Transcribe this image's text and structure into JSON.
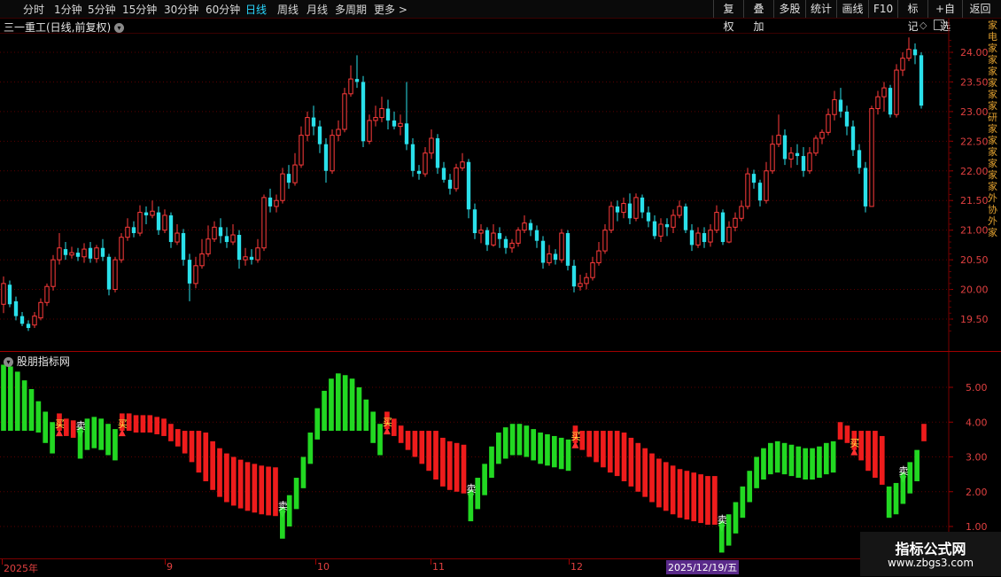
{
  "toolbar": {
    "periods": [
      "分时",
      "1分钟",
      "5分钟",
      "15分钟",
      "30分钟",
      "60分钟",
      "日线",
      "周线",
      "月线",
      "多周期",
      "更多 >"
    ],
    "active_period": "日线",
    "buttons": [
      "复权",
      "叠加",
      "多股",
      "统计",
      "画线",
      "F10",
      "标记",
      "+自选",
      "返回"
    ]
  },
  "chart": {
    "title": "三一重工(日线,前复权)",
    "price_axis": [
      "24.00",
      "23.50",
      "23.00",
      "22.50",
      "22.00",
      "21.50",
      "21.00",
      "20.50",
      "20.00",
      "19.50"
    ],
    "indicator_title": "股朋指标网",
    "indicator_axis": [
      "5.00",
      "4.00",
      "3.00",
      "2.00",
      "1.00"
    ],
    "date_labels": [
      "2025年",
      "9",
      "10",
      "11",
      "12"
    ],
    "selected_date": "2025/12/19/五",
    "buy_label": "买",
    "sell_label": "卖",
    "colors": {
      "up": "#ff3b3b",
      "down": "#2ae0ea",
      "bar_green": "#22d822",
      "bar_red": "#ee1c1c",
      "grid": "#5a0000"
    }
  },
  "chart_data": [
    {
      "type": "candlestick",
      "title": "三一重工(日线,前复权)",
      "ylim": [
        19.2,
        24.5
      ],
      "candles": [
        [
          19.75,
          20.1,
          20.22,
          19.6
        ],
        [
          20.08,
          19.75,
          20.15,
          19.7
        ],
        [
          19.8,
          19.55,
          19.88,
          19.48
        ],
        [
          19.55,
          19.42,
          19.62,
          19.38
        ],
        [
          19.42,
          19.35,
          19.48,
          19.3
        ],
        [
          19.4,
          19.55,
          19.62,
          19.35
        ],
        [
          19.52,
          19.78,
          19.85,
          19.48
        ],
        [
          19.78,
          20.05,
          20.1,
          19.72
        ],
        [
          20.05,
          20.5,
          20.58,
          19.98
        ],
        [
          20.5,
          20.7,
          20.95,
          20.42
        ],
        [
          20.68,
          20.58,
          20.8,
          20.5
        ],
        [
          20.58,
          20.62,
          20.72,
          20.52
        ],
        [
          20.62,
          20.55,
          20.7,
          20.48
        ],
        [
          20.55,
          20.68,
          20.78,
          20.45
        ],
        [
          20.7,
          20.52,
          20.8,
          20.45
        ],
        [
          20.52,
          20.7,
          20.75,
          20.45
        ],
        [
          20.7,
          20.55,
          20.85,
          20.48
        ],
        [
          20.55,
          20.0,
          20.6,
          19.9
        ],
        [
          20.0,
          20.5,
          20.55,
          19.95
        ],
        [
          20.5,
          20.88,
          20.95,
          20.45
        ],
        [
          20.88,
          21.05,
          21.2,
          20.82
        ],
        [
          21.05,
          20.95,
          21.15,
          20.88
        ],
        [
          20.95,
          21.3,
          21.42,
          20.9
        ],
        [
          21.3,
          21.25,
          21.4,
          21.1
        ],
        [
          21.25,
          21.32,
          21.5,
          21.2
        ],
        [
          21.3,
          21.0,
          21.4,
          20.92
        ],
        [
          21.0,
          21.25,
          21.35,
          20.95
        ],
        [
          21.25,
          20.8,
          21.3,
          20.7
        ],
        [
          20.8,
          20.95,
          21.1,
          20.75
        ],
        [
          20.95,
          20.5,
          21.02,
          20.4
        ],
        [
          20.5,
          20.1,
          20.6,
          19.8
        ],
        [
          20.1,
          20.4,
          20.55,
          20.02
        ],
        [
          20.4,
          20.6,
          20.85,
          20.35
        ],
        [
          20.6,
          20.85,
          21.08,
          20.55
        ],
        [
          20.85,
          21.05,
          21.15,
          20.8
        ],
        [
          21.05,
          20.9,
          21.2,
          20.78
        ],
        [
          20.9,
          20.8,
          21.05,
          20.7
        ],
        [
          20.8,
          20.92,
          21.1,
          20.75
        ],
        [
          20.92,
          20.5,
          21.0,
          20.35
        ],
        [
          20.5,
          20.55,
          20.7,
          20.4
        ],
        [
          20.55,
          20.5,
          20.68,
          20.42
        ],
        [
          20.5,
          20.7,
          20.85,
          20.45
        ],
        [
          20.7,
          21.55,
          21.6,
          20.65
        ],
        [
          21.55,
          21.4,
          21.7,
          21.3
        ],
        [
          21.4,
          21.5,
          21.6,
          21.3
        ],
        [
          21.5,
          21.95,
          22.05,
          21.45
        ],
        [
          21.95,
          21.8,
          22.1,
          21.7
        ],
        [
          21.8,
          22.1,
          22.3,
          21.75
        ],
        [
          22.1,
          22.6,
          22.75,
          22.05
        ],
        [
          22.6,
          22.9,
          23.0,
          22.5
        ],
        [
          22.9,
          22.75,
          23.1,
          22.6
        ],
        [
          22.75,
          22.45,
          22.85,
          22.3
        ],
        [
          22.45,
          22.0,
          22.55,
          21.8
        ],
        [
          22.0,
          22.6,
          22.7,
          21.95
        ],
        [
          22.6,
          22.7,
          22.85,
          22.5
        ],
        [
          22.7,
          23.3,
          23.4,
          22.65
        ],
        [
          23.3,
          23.55,
          23.78,
          23.25
        ],
        [
          23.55,
          23.5,
          23.95,
          23.4
        ],
        [
          23.5,
          22.5,
          23.6,
          22.4
        ],
        [
          22.5,
          22.85,
          22.95,
          22.45
        ],
        [
          22.85,
          22.9,
          23.1,
          22.75
        ],
        [
          22.9,
          23.05,
          23.25,
          22.82
        ],
        [
          23.05,
          22.85,
          23.2,
          22.7
        ],
        [
          22.85,
          22.75,
          23.0,
          22.7
        ],
        [
          22.75,
          22.8,
          22.95,
          22.6
        ],
        [
          22.8,
          22.45,
          23.5,
          22.35
        ],
        [
          22.45,
          22.0,
          22.55,
          21.9
        ],
        [
          22.0,
          21.95,
          22.1,
          21.85
        ],
        [
          21.95,
          22.3,
          22.4,
          21.9
        ],
        [
          22.3,
          22.55,
          22.7,
          22.2
        ],
        [
          22.55,
          22.05,
          22.62,
          21.95
        ],
        [
          22.05,
          21.85,
          22.15,
          21.8
        ],
        [
          21.85,
          21.7,
          21.95,
          21.6
        ],
        [
          21.7,
          22.05,
          22.12,
          21.65
        ],
        [
          22.05,
          22.15,
          22.3,
          22.0
        ],
        [
          22.15,
          21.35,
          22.2,
          21.2
        ],
        [
          21.35,
          20.95,
          21.45,
          20.85
        ],
        [
          20.95,
          21.0,
          21.1,
          20.78
        ],
        [
          21.0,
          20.75,
          21.05,
          20.65
        ],
        [
          20.75,
          20.95,
          21.1,
          20.72
        ],
        [
          20.95,
          20.85,
          21.05,
          20.7
        ],
        [
          20.85,
          20.7,
          20.9,
          20.6
        ],
        [
          20.7,
          20.78,
          20.85,
          20.62
        ],
        [
          20.78,
          21.0,
          21.05,
          20.72
        ],
        [
          21.0,
          21.12,
          21.25,
          20.95
        ],
        [
          21.12,
          21.0,
          21.18,
          20.9
        ],
        [
          21.0,
          20.82,
          21.08,
          20.7
        ],
        [
          20.82,
          20.45,
          20.9,
          20.35
        ],
        [
          20.45,
          20.6,
          20.75,
          20.4
        ],
        [
          20.6,
          20.5,
          20.68,
          20.42
        ],
        [
          20.5,
          20.95,
          21.02,
          20.45
        ],
        [
          20.95,
          20.4,
          21.0,
          20.32
        ],
        [
          20.4,
          20.05,
          20.5,
          19.95
        ],
        [
          20.05,
          20.1,
          20.25,
          19.98
        ],
        [
          20.1,
          20.2,
          20.28,
          20.0
        ],
        [
          20.2,
          20.45,
          20.55,
          20.15
        ],
        [
          20.45,
          20.65,
          20.8,
          20.4
        ],
        [
          20.65,
          21.0,
          21.1,
          20.6
        ],
        [
          21.0,
          21.4,
          21.48,
          20.95
        ],
        [
          21.4,
          21.3,
          21.5,
          21.15
        ],
        [
          21.3,
          21.45,
          21.55,
          21.2
        ],
        [
          21.45,
          21.2,
          21.62,
          21.1
        ],
        [
          21.2,
          21.55,
          21.62,
          21.15
        ],
        [
          21.55,
          21.3,
          21.6,
          21.2
        ],
        [
          21.3,
          21.15,
          21.4,
          21.05
        ],
        [
          21.15,
          20.9,
          21.25,
          20.85
        ],
        [
          20.9,
          21.1,
          21.2,
          20.8
        ],
        [
          21.1,
          21.05,
          21.2,
          20.9
        ],
        [
          21.05,
          21.25,
          21.35,
          20.95
        ],
        [
          21.25,
          21.4,
          21.5,
          21.2
        ],
        [
          21.4,
          21.0,
          21.45,
          20.95
        ],
        [
          21.0,
          20.75,
          21.1,
          20.65
        ],
        [
          20.75,
          20.95,
          21.05,
          20.7
        ],
        [
          20.95,
          20.8,
          21.05,
          20.7
        ],
        [
          20.8,
          21.0,
          21.1,
          20.72
        ],
        [
          21.0,
          21.3,
          21.42,
          20.95
        ],
        [
          21.3,
          20.8,
          21.35,
          20.75
        ],
        [
          20.8,
          21.05,
          21.15,
          20.78
        ],
        [
          21.05,
          21.2,
          21.3,
          20.98
        ],
        [
          21.2,
          21.4,
          21.5,
          21.15
        ],
        [
          21.4,
          21.95,
          22.05,
          21.35
        ],
        [
          21.95,
          21.8,
          22.02,
          21.7
        ],
        [
          21.8,
          21.5,
          21.85,
          21.4
        ],
        [
          21.5,
          22.0,
          22.15,
          21.45
        ],
        [
          22.0,
          22.45,
          22.6,
          21.95
        ],
        [
          22.45,
          22.6,
          22.95,
          22.4
        ],
        [
          22.6,
          22.2,
          22.7,
          22.1
        ],
        [
          22.2,
          22.3,
          22.4,
          22.05
        ],
        [
          22.3,
          22.25,
          22.45,
          22.1
        ],
        [
          22.25,
          22.0,
          22.4,
          21.9
        ],
        [
          22.0,
          22.3,
          22.4,
          21.95
        ],
        [
          22.3,
          22.55,
          22.6,
          22.25
        ],
        [
          22.55,
          22.65,
          22.7,
          22.45
        ],
        [
          22.65,
          22.95,
          23.05,
          22.6
        ],
        [
          22.95,
          23.2,
          23.35,
          22.85
        ],
        [
          23.2,
          23.0,
          23.4,
          22.9
        ],
        [
          23.0,
          22.75,
          23.1,
          22.6
        ],
        [
          22.75,
          22.35,
          22.85,
          22.25
        ],
        [
          22.35,
          22.05,
          22.45,
          21.95
        ],
        [
          22.05,
          21.4,
          22.15,
          21.3
        ],
        [
          21.4,
          23.05,
          23.1,
          21.4
        ],
        [
          23.05,
          23.25,
          23.35,
          22.95
        ],
        [
          23.25,
          23.4,
          23.5,
          23.0
        ],
        [
          23.4,
          22.95,
          23.45,
          22.9
        ],
        [
          22.95,
          23.7,
          23.8,
          22.9
        ],
        [
          23.7,
          23.9,
          24.0,
          23.6
        ],
        [
          23.9,
          24.05,
          24.25,
          23.85
        ],
        [
          24.05,
          23.95,
          24.15,
          23.8
        ],
        [
          23.95,
          23.1,
          24.0,
          23.05
        ]
      ]
    },
    {
      "type": "bar",
      "title": "股朋指标网",
      "ylim": [
        0.6,
        6.0
      ],
      "values": [
        5.65,
        5.6,
        5.45,
        5.2,
        4.95,
        4.6,
        4.3,
        4.0,
        3.75,
        3.6,
        3.55,
        3.85,
        4.1,
        4.15,
        4.1,
        3.95,
        3.8,
        3.75,
        3.75,
        3.7,
        3.7,
        3.7,
        3.65,
        3.6,
        3.45,
        3.3,
        3.1,
        2.85,
        2.55,
        2.3,
        2.05,
        1.85,
        1.7,
        1.6,
        1.52,
        1.45,
        1.4,
        1.35,
        1.32,
        1.3,
        1.55,
        1.9,
        2.4,
        3.0,
        3.7,
        4.4,
        4.9,
        5.25,
        5.4,
        5.35,
        5.25,
        5.0,
        4.65,
        4.3,
        3.95,
        3.8,
        3.6,
        3.4,
        3.2,
        3.0,
        2.8,
        2.6,
        2.35,
        2.15,
        2.05,
        2.0,
        1.95,
        2.05,
        2.4,
        2.8,
        3.3,
        3.7,
        3.85,
        3.95,
        3.95,
        3.9,
        3.8,
        3.7,
        3.65,
        3.6,
        3.55,
        3.5,
        3.4,
        3.2,
        3.0,
        2.85,
        2.7,
        2.55,
        2.45,
        2.3,
        2.15,
        2.0,
        1.85,
        1.7,
        1.55,
        1.45,
        1.35,
        1.25,
        1.2,
        1.15,
        1.1,
        1.05,
        1.05,
        1.15,
        1.35,
        1.7,
        2.15,
        2.6,
        3.0,
        3.25,
        3.4,
        3.45,
        3.4,
        3.35,
        3.3,
        3.25,
        3.25,
        3.3,
        3.4,
        3.45,
        3.5,
        3.4,
        3.2,
        2.9,
        2.6,
        2.4,
        2.2,
        2.15,
        2.25,
        2.55,
        2.85,
        3.2,
        3.45
      ],
      "colors": [
        "green",
        "green",
        "green",
        "green",
        "green",
        "green",
        "green",
        "green",
        "red",
        "red",
        "red",
        "green",
        "green",
        "green",
        "green",
        "green",
        "green",
        "red",
        "red",
        "red",
        "red",
        "red",
        "red",
        "red",
        "red",
        "red",
        "red",
        "red",
        "red",
        "red",
        "red",
        "red",
        "red",
        "red",
        "red",
        "red",
        "red",
        "red",
        "red",
        "red",
        "green",
        "green",
        "green",
        "green",
        "green",
        "green",
        "green",
        "green",
        "green",
        "green",
        "green",
        "green",
        "green",
        "green",
        "green",
        "red",
        "red",
        "red",
        "red",
        "red",
        "red",
        "red",
        "red",
        "red",
        "red",
        "red",
        "red",
        "green",
        "green",
        "green",
        "green",
        "green",
        "green",
        "green",
        "green",
        "green",
        "green",
        "green",
        "green",
        "green",
        "green",
        "green",
        "red",
        "red",
        "red",
        "red",
        "red",
        "red",
        "red",
        "red",
        "red",
        "red",
        "red",
        "red",
        "red",
        "red",
        "red",
        "red",
        "red",
        "red",
        "red",
        "red",
        "red",
        "green",
        "green",
        "green",
        "green",
        "green",
        "green",
        "green",
        "green",
        "green",
        "green",
        "green",
        "green",
        "green",
        "green",
        "green",
        "green",
        "green",
        "red",
        "red",
        "red",
        "red",
        "red",
        "red",
        "red",
        "green",
        "green",
        "green",
        "green",
        "green"
      ],
      "signals": [
        {
          "index": 8,
          "type": "买"
        },
        {
          "index": 11,
          "type": "卖"
        },
        {
          "index": 17,
          "type": "买"
        },
        {
          "index": 40,
          "type": "卖"
        },
        {
          "index": 55,
          "type": "买"
        },
        {
          "index": 67,
          "type": "卖"
        },
        {
          "index": 82,
          "type": "买"
        },
        {
          "index": 103,
          "type": "卖"
        },
        {
          "index": 122,
          "type": "买"
        },
        {
          "index": 129,
          "type": "卖"
        }
      ]
    }
  ],
  "watermark": {
    "title": "指标公式网",
    "url": "www.zbgs3.com"
  },
  "side_text": "家电家家家家家家研家家家家家家外协外家"
}
